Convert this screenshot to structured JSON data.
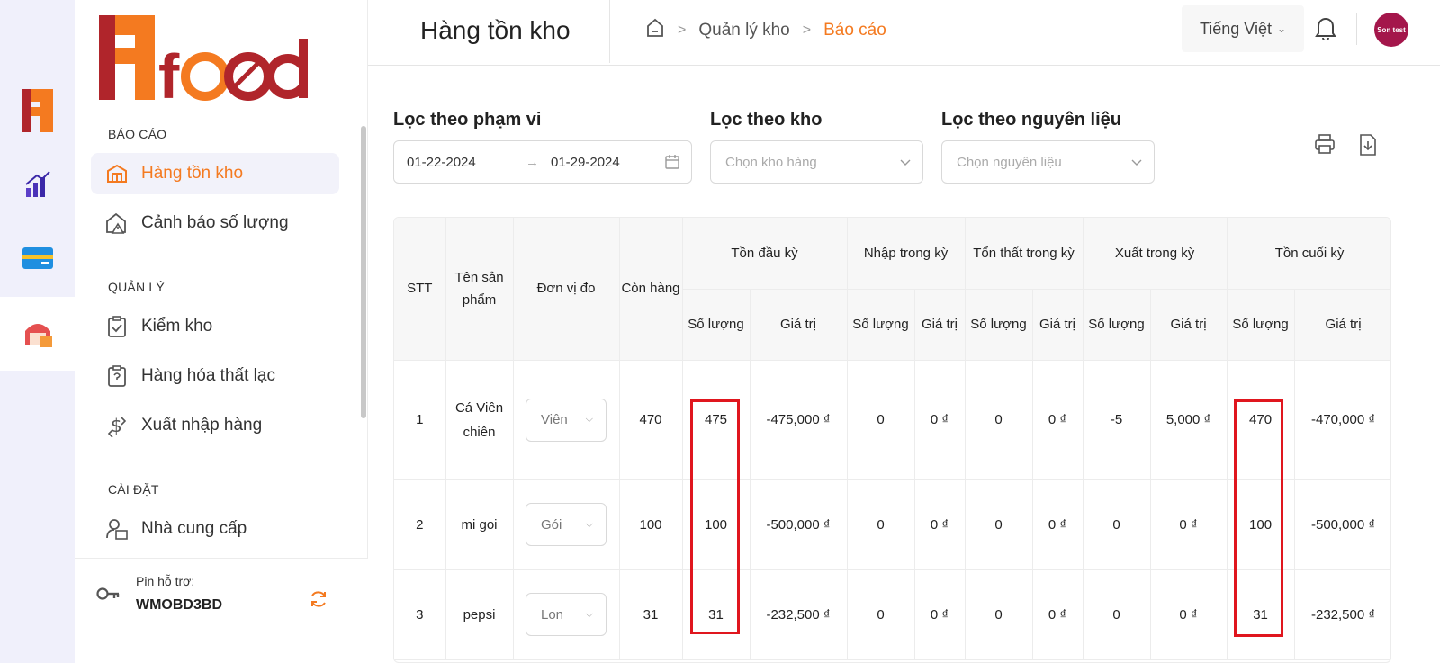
{
  "rail": {
    "items": [
      "logo-f",
      "reports-chart",
      "card",
      "warehouse"
    ]
  },
  "sidebar": {
    "sections": [
      {
        "title": "BÁO CÁO",
        "items": [
          "Hàng tồn kho",
          "Cảnh báo số lượng"
        ]
      },
      {
        "title": "QUẢN LÝ",
        "items": [
          "Kiểm kho",
          "Hàng hóa thất lạc",
          "Xuất nhập hàng"
        ]
      },
      {
        "title": "CÀI ĐẶT",
        "items": [
          "Nhà cung cấp"
        ]
      }
    ],
    "support_label": "Pin hỗ trợ:",
    "support_code": "WMOBD3BD"
  },
  "header": {
    "title": "Hàng tồn kho",
    "breadcrumb": [
      "Quản lý kho",
      "Báo cáo"
    ],
    "language": "Tiếng Việt",
    "avatar_text": "Son test"
  },
  "filters": {
    "range_label": "Lọc theo phạm vi",
    "date_from": "01-22-2024",
    "date_to": "01-29-2024",
    "warehouse_label": "Lọc theo kho",
    "warehouse_placeholder": "Chọn kho hàng",
    "ingredient_label": "Lọc theo nguyên liệu",
    "ingredient_placeholder": "Chọn nguyên liệu"
  },
  "table": {
    "headers": {
      "stt": "STT",
      "product": "Tên sản phẩm",
      "unit": "Đơn vị đo",
      "remaining": "Còn hàng",
      "opening": "Tồn đầu kỳ",
      "import": "Nhập trong kỳ",
      "loss": "Tổn thất trong kỳ",
      "export": "Xuất trong kỳ",
      "closing": "Tồn cuối kỳ",
      "qty": "Số lượng",
      "value": "Giá trị"
    },
    "rows": [
      {
        "stt": "1",
        "name": "Cá Viên chiên",
        "unit": "Viên",
        "remaining": "470",
        "open_qty": "475",
        "open_val": "-475,000 ₫",
        "imp_qty": "0",
        "imp_val": "0 ₫",
        "loss_qty": "0",
        "loss_val": "0 ₫",
        "exp_qty": "-5",
        "exp_val": "5,000 ₫",
        "close_qty": "470",
        "close_val": "-470,000 ₫"
      },
      {
        "stt": "2",
        "name": "mi goi",
        "unit": "Gói",
        "remaining": "100",
        "open_qty": "100",
        "open_val": "-500,000 ₫",
        "imp_qty": "0",
        "imp_val": "0 ₫",
        "loss_qty": "0",
        "loss_val": "0 ₫",
        "exp_qty": "0",
        "exp_val": "0 ₫",
        "close_qty": "100",
        "close_val": "-500,000 ₫"
      },
      {
        "stt": "3",
        "name": "pepsi",
        "unit": "Lon",
        "remaining": "31",
        "open_qty": "31",
        "open_val": "-232,500 ₫",
        "imp_qty": "0",
        "imp_val": "0 ₫",
        "loss_qty": "0",
        "loss_val": "0 ₫",
        "exp_qty": "0",
        "exp_val": "0 ₫",
        "close_qty": "31",
        "close_val": "-232,500 ₫"
      }
    ]
  },
  "colors": {
    "accent": "#f47a20",
    "brand_red": "#b0252b",
    "highlight": "#e0161e",
    "avatar": "#a4164b"
  }
}
